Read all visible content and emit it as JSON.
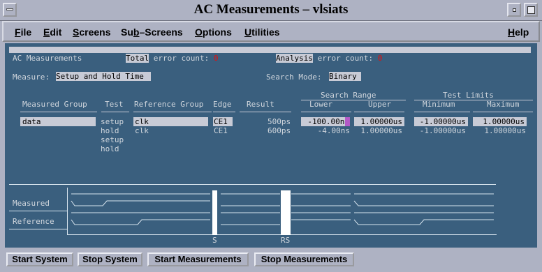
{
  "window": {
    "title": "AC Measurements – vlsiats"
  },
  "menubar": {
    "items": [
      {
        "label": "File",
        "key": "F"
      },
      {
        "label": "Edit",
        "key": "E"
      },
      {
        "label": "Screens",
        "key": "S"
      },
      {
        "label": "Sub-Screens",
        "key": "b"
      },
      {
        "label": "Options",
        "key": "O"
      },
      {
        "label": "Utilities",
        "key": "U"
      },
      {
        "label": "Help",
        "key": "H"
      }
    ]
  },
  "main": {
    "header": {
      "left_label": "AC Measurements",
      "total_word": "Total",
      "total_rest": " error count:",
      "total_value": "0",
      "analysis_word": "Analysis",
      "analysis_rest": " error count:",
      "analysis_value": "0"
    },
    "measure": {
      "label": "Measure:",
      "value": "Setup and Hold Time"
    },
    "search_mode": {
      "label": "Search Mode:",
      "value": "Binary"
    },
    "group_headers": {
      "search_range": "Search Range",
      "test_limits": "Test Limits"
    },
    "columns": {
      "measured_group": "Measured Group",
      "test": "Test",
      "reference_group": "Reference Group",
      "edge": "Edge",
      "result": "Result",
      "lower": "Lower",
      "upper": "Upper",
      "minimum": "Minimum",
      "maximum": "Maximum"
    },
    "rows": [
      {
        "measured_group": "data",
        "test": "setup",
        "reference_group": "clk",
        "edge": "CE1",
        "result": "500ps",
        "lower": "-100.00ns",
        "upper": "1.00000us",
        "minimum": "-1.00000us",
        "maximum": "1.00000us"
      },
      {
        "measured_group": "",
        "test": "hold",
        "reference_group": "clk",
        "edge": "CE1",
        "result": "600ps",
        "lower": "-4.00ns",
        "upper": "1.00000us",
        "minimum": "-1.00000us",
        "maximum": "1.00000us"
      },
      {
        "measured_group": "",
        "test": "setup",
        "reference_group": "",
        "edge": "",
        "result": "",
        "lower": "",
        "upper": "",
        "minimum": "",
        "maximum": ""
      },
      {
        "measured_group": "",
        "test": "hold",
        "reference_group": "",
        "edge": "",
        "result": "",
        "lower": "",
        "upper": "",
        "minimum": "",
        "maximum": ""
      }
    ],
    "waveform": {
      "measured_label": "Measured",
      "reference_label": "Reference",
      "marker_s": "S",
      "marker_rs": "RS"
    }
  },
  "toolbar": {
    "start_system": "Start System",
    "stop_system": "Stop System",
    "start_measurements": "Start Measurements",
    "stop_measurements": "Stop Measurements"
  },
  "colors": {
    "panel_bg": "#3a5f7e",
    "chrome_bg": "#aeb2c3",
    "field_bg": "#c8cbd6",
    "error_red": "#e01010",
    "waveform": "#d7e4ee"
  }
}
